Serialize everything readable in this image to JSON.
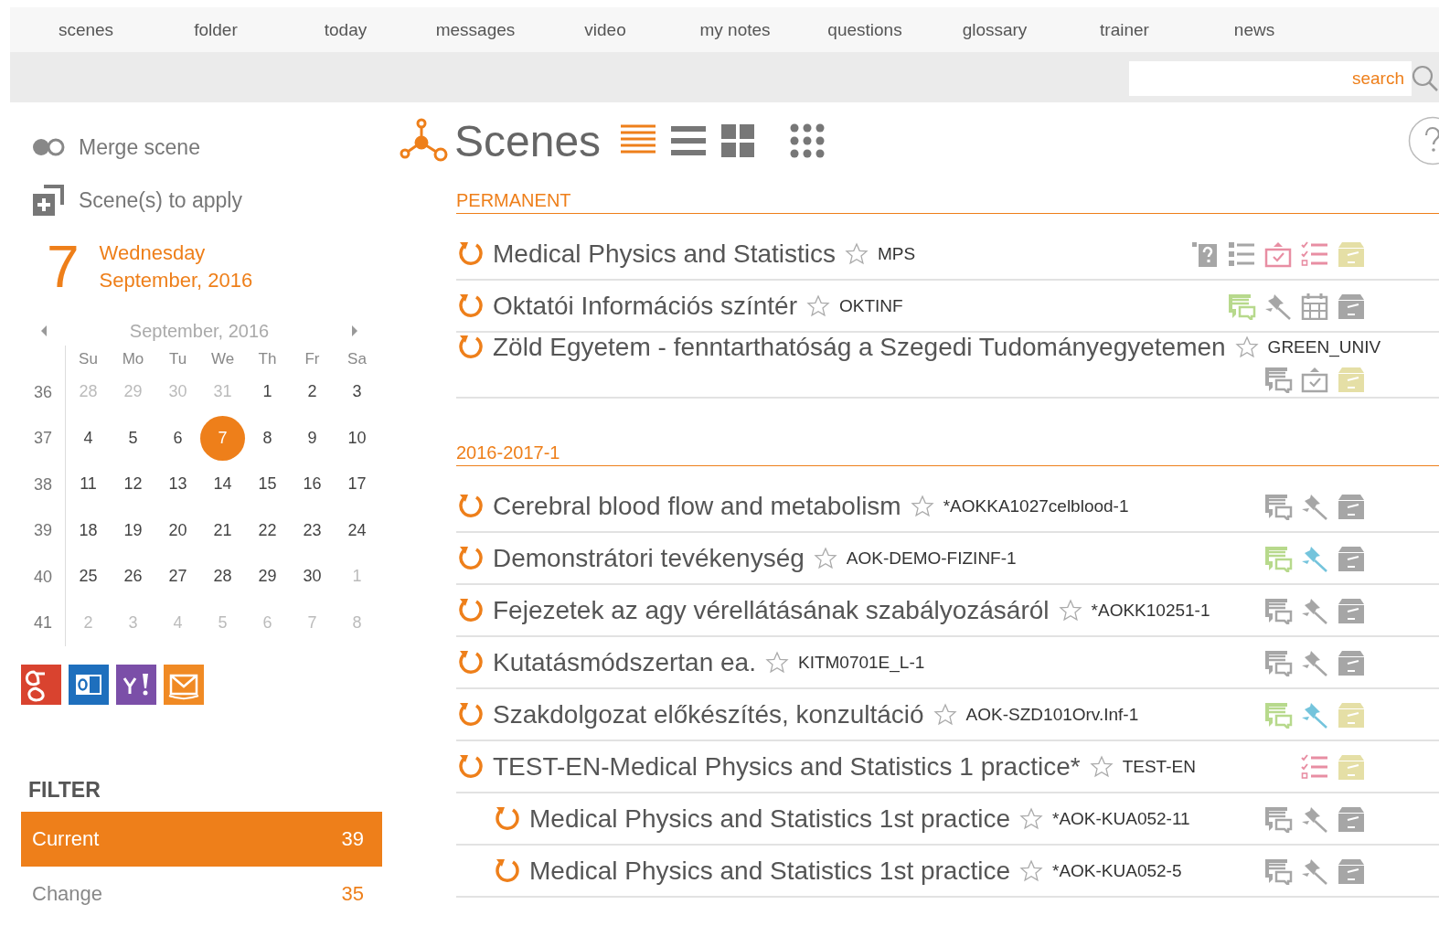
{
  "nav": [
    {
      "label": "scenes"
    },
    {
      "label": "folder"
    },
    {
      "label": "today"
    },
    {
      "label": "messages"
    },
    {
      "label": "video"
    },
    {
      "label": "my notes"
    },
    {
      "label": "questions"
    },
    {
      "label": "glossary"
    },
    {
      "label": "trainer"
    },
    {
      "label": "news"
    }
  ],
  "search": {
    "placeholder": "search"
  },
  "sidebar": {
    "actions": [
      {
        "kind": "merge",
        "label": "Merge scene"
      },
      {
        "kind": "apply",
        "label": "Scene(s) to apply"
      }
    ],
    "date": {
      "day": "7",
      "weekday": "Wednesday",
      "month_year": "September, 2016"
    },
    "calendar": {
      "title": "September, 2016",
      "weekdays": [
        "Su",
        "Mo",
        "Tu",
        "We",
        "Th",
        "Fr",
        "Sa"
      ],
      "weeks": [
        {
          "week": "36",
          "days": [
            {
              "day": "28",
              "muted": true,
              "selected": false
            },
            {
              "day": "29",
              "muted": true,
              "selected": false
            },
            {
              "day": "30",
              "muted": true,
              "selected": false
            },
            {
              "day": "31",
              "muted": true,
              "selected": false
            },
            {
              "day": "1",
              "muted": false,
              "selected": false
            },
            {
              "day": "2",
              "muted": false,
              "selected": false
            },
            {
              "day": "3",
              "muted": false,
              "selected": false
            }
          ]
        },
        {
          "week": "37",
          "days": [
            {
              "day": "4",
              "muted": false,
              "selected": false
            },
            {
              "day": "5",
              "muted": false,
              "selected": false
            },
            {
              "day": "6",
              "muted": false,
              "selected": false
            },
            {
              "day": "7",
              "muted": false,
              "selected": true
            },
            {
              "day": "8",
              "muted": false,
              "selected": false
            },
            {
              "day": "9",
              "muted": false,
              "selected": false
            },
            {
              "day": "10",
              "muted": false,
              "selected": false
            }
          ]
        },
        {
          "week": "38",
          "days": [
            {
              "day": "11",
              "muted": false,
              "selected": false
            },
            {
              "day": "12",
              "muted": false,
              "selected": false
            },
            {
              "day": "13",
              "muted": false,
              "selected": false
            },
            {
              "day": "14",
              "muted": false,
              "selected": false
            },
            {
              "day": "15",
              "muted": false,
              "selected": false
            },
            {
              "day": "16",
              "muted": false,
              "selected": false
            },
            {
              "day": "17",
              "muted": false,
              "selected": false
            }
          ]
        },
        {
          "week": "39",
          "days": [
            {
              "day": "18",
              "muted": false,
              "selected": false
            },
            {
              "day": "19",
              "muted": false,
              "selected": false
            },
            {
              "day": "20",
              "muted": false,
              "selected": false
            },
            {
              "day": "21",
              "muted": false,
              "selected": false
            },
            {
              "day": "22",
              "muted": false,
              "selected": false
            },
            {
              "day": "23",
              "muted": false,
              "selected": false
            },
            {
              "day": "24",
              "muted": false,
              "selected": false
            }
          ]
        },
        {
          "week": "40",
          "days": [
            {
              "day": "25",
              "muted": false,
              "selected": false
            },
            {
              "day": "26",
              "muted": false,
              "selected": false
            },
            {
              "day": "27",
              "muted": false,
              "selected": false
            },
            {
              "day": "28",
              "muted": false,
              "selected": false
            },
            {
              "day": "29",
              "muted": false,
              "selected": false
            },
            {
              "day": "30",
              "muted": false,
              "selected": false
            },
            {
              "day": "1",
              "muted": true,
              "selected": false
            }
          ]
        },
        {
          "week": "41",
          "days": [
            {
              "day": "2",
              "muted": true,
              "selected": false
            },
            {
              "day": "3",
              "muted": true,
              "selected": false
            },
            {
              "day": "4",
              "muted": true,
              "selected": false
            },
            {
              "day": "5",
              "muted": true,
              "selected": false
            },
            {
              "day": "6",
              "muted": true,
              "selected": false
            },
            {
              "day": "7",
              "muted": true,
              "selected": false
            },
            {
              "day": "8",
              "muted": true,
              "selected": false
            }
          ]
        }
      ]
    },
    "calendar_services": [
      {
        "kind": "google",
        "color": "#d9432f"
      },
      {
        "kind": "outlook",
        "color": "#1e6fbd"
      },
      {
        "kind": "yahoo",
        "color": "#7b4fa8"
      },
      {
        "kind": "mail",
        "color": "#f08a24"
      }
    ],
    "filter": {
      "title": "FILTER",
      "items": [
        {
          "label": "Current",
          "count": "39",
          "selected": true
        },
        {
          "label": "Change",
          "count": "35",
          "selected": false
        }
      ]
    }
  },
  "main": {
    "title": "Scenes",
    "views": [
      {
        "kind": "lines",
        "selected": true
      },
      {
        "kind": "list",
        "selected": false
      },
      {
        "kind": "tiles",
        "selected": false
      },
      {
        "kind": "dots",
        "selected": false
      }
    ],
    "sections": [
      {
        "title": "PERMANENT",
        "scenes": [
          {
            "title": "Medical Physics and Statistics",
            "code": "MPS",
            "icons": [
              {
                "kind": "question",
                "color": "#a6a6a6"
              },
              {
                "kind": "list",
                "color": "#a6a6a6"
              },
              {
                "kind": "task",
                "color": "#e88ea3"
              },
              {
                "kind": "checklist",
                "color": "#e88ea3"
              },
              {
                "kind": "archive",
                "color": "#e5dfa6"
              }
            ]
          },
          {
            "title": "Oktatói Információs színtér",
            "code": "OKTINF",
            "icons": [
              {
                "kind": "comment",
                "color": "#b7d98c"
              },
              {
                "kind": "pin",
                "color": "#a6a6a6"
              },
              {
                "kind": "calendar",
                "color": "#a6a6a6"
              },
              {
                "kind": "archive",
                "color": "#a6a6a6"
              }
            ]
          },
          {
            "title": "Zöld Egyetem - fenntarthatóság a Szegedi Tudományegyetemen",
            "code": "GREEN_UNIV",
            "icons": [
              {
                "kind": "comment",
                "color": "#a6a6a6"
              },
              {
                "kind": "task",
                "color": "#a6a6a6"
              },
              {
                "kind": "archive",
                "color": "#e5dfa6"
              }
            ]
          }
        ]
      },
      {
        "title": "2016-2017-1",
        "scenes": [
          {
            "title": "Cerebral blood flow and metabolism",
            "code": "*AOKKA1027celblood-1",
            "icons": [
              {
                "kind": "comment",
                "color": "#a6a6a6"
              },
              {
                "kind": "pin",
                "color": "#a6a6a6"
              },
              {
                "kind": "archive",
                "color": "#a6a6a6"
              }
            ]
          },
          {
            "title": "Demonstrátori tevékenység",
            "code": "AOK-DEMO-FIZINF-1",
            "icons": [
              {
                "kind": "comment",
                "color": "#b7d98c"
              },
              {
                "kind": "pin",
                "color": "#74c4dc"
              },
              {
                "kind": "archive",
                "color": "#a6a6a6"
              }
            ]
          },
          {
            "title": "Fejezetek az agy vérellátásának szabályozásáról",
            "code": "*AOKK10251-1",
            "icons": [
              {
                "kind": "comment",
                "color": "#a6a6a6"
              },
              {
                "kind": "pin",
                "color": "#a6a6a6"
              },
              {
                "kind": "archive",
                "color": "#a6a6a6"
              }
            ]
          },
          {
            "title": "Kutatásmódszertan ea.",
            "code": "KITM0701E_L-1",
            "icons": [
              {
                "kind": "comment",
                "color": "#a6a6a6"
              },
              {
                "kind": "pin",
                "color": "#a6a6a6"
              },
              {
                "kind": "archive",
                "color": "#a6a6a6"
              }
            ]
          },
          {
            "title": "Szakdolgozat előkészítés, konzultáció",
            "code": "AOK-SZD101Orv.Inf-1",
            "icons": [
              {
                "kind": "comment",
                "color": "#b7d98c"
              },
              {
                "kind": "pin",
                "color": "#74c4dc"
              },
              {
                "kind": "archive",
                "color": "#e5dfa6"
              }
            ]
          },
          {
            "title": "TEST-EN-Medical Physics and Statistics 1 practice*",
            "code": "TEST-EN",
            "icons": [
              {
                "kind": "checklist",
                "color": "#e88ea3"
              },
              {
                "kind": "archive",
                "color": "#e5dfa6"
              }
            ],
            "children": [
              {
                "title": "Medical Physics and Statistics 1st practice",
                "code": "*AOK-KUA052-11",
                "icons": [
                  {
                    "kind": "comment",
                    "color": "#a6a6a6"
                  },
                  {
                    "kind": "pin",
                    "color": "#a6a6a6"
                  },
                  {
                    "kind": "archive",
                    "color": "#a6a6a6"
                  }
                ]
              },
              {
                "title": "Medical Physics and Statistics 1st practice",
                "code": "*AOK-KUA052-5",
                "icons": [
                  {
                    "kind": "comment",
                    "color": "#a6a6a6"
                  },
                  {
                    "kind": "pin",
                    "color": "#a6a6a6"
                  },
                  {
                    "kind": "archive",
                    "color": "#a6a6a6"
                  }
                ]
              }
            ]
          }
        ]
      }
    ]
  }
}
